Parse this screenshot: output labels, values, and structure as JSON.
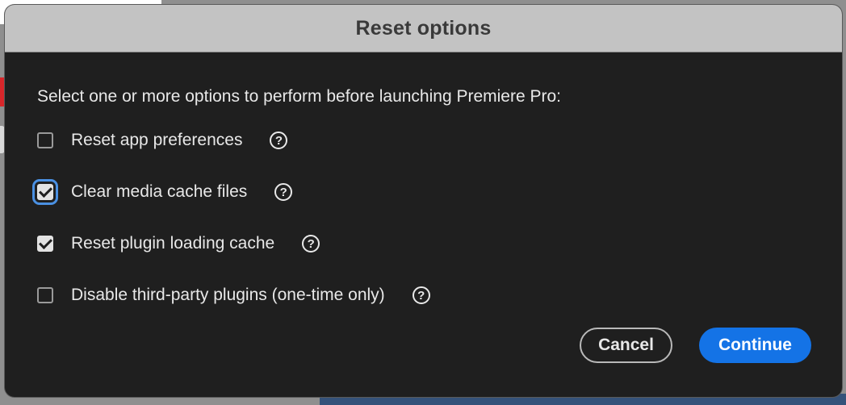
{
  "dialog": {
    "title": "Reset options",
    "prompt": "Select one or more options to perform before launching Premiere Pro:",
    "options": [
      {
        "label": "Reset app preferences",
        "checked": false,
        "focused": false,
        "help_icon": "question-circle-icon"
      },
      {
        "label": "Clear media cache files",
        "checked": true,
        "focused": true,
        "help_icon": "question-circle-icon"
      },
      {
        "label": "Reset plugin loading cache",
        "checked": true,
        "focused": false,
        "help_icon": "question-circle-icon"
      },
      {
        "label": "Disable third-party plugins (one-time only)",
        "checked": false,
        "focused": false,
        "help_icon": "question-circle-icon"
      }
    ],
    "help_glyph": "?",
    "buttons": {
      "cancel_label": "Cancel",
      "continue_label": "Continue"
    }
  },
  "colors": {
    "dialog_bg": "#1f1f1f",
    "titlebar_bg": "#c3c3c3",
    "accent": "#1473e6",
    "focus_ring": "#4a90e2"
  }
}
